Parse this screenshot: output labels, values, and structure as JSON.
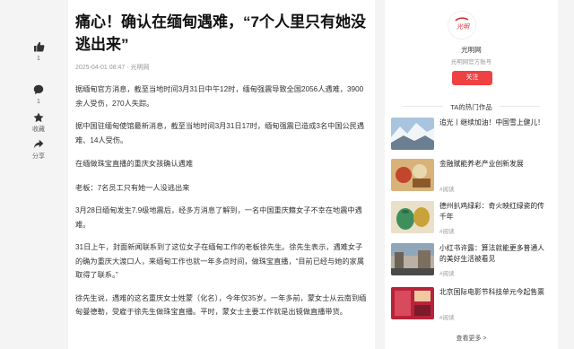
{
  "actions": {
    "like_count": "1",
    "comment_count": "1",
    "favorite_label": "收藏",
    "share_label": "分享"
  },
  "article": {
    "title": "痛心！确认在缅甸遇难，“7个人里只有她没逃出来”",
    "meta": "2025-04-01 08:47 · 光明网",
    "paragraphs": [
      "据缅甸官方消息，截至当地时间3月31日中午12时，缅甸强震导致全国2056人遇难，3900余人受伤，270人失踪。",
      "据中国驻缅甸使馆最新消息，截至当地时间3月31日17时，缅甸强震已造成3名中国公民遇难、14人受伤。",
      "在缅做珠宝直播的重庆女孩确认遇难",
      "老板：7名员工只有她一人没逃出来",
      "3月28日缅甸发生7.9级地震后，经多方消息了解到，一名中国重庆籍女子不幸在地震中遇难。",
      "31日上午，封面新闻联系到了这位女子在缅甸工作的老板徐先生。徐先生表示，遇难女子的确为重庆大渡口人，来缅甸工作也就一年多点时间，做珠宝直播，“目前已经与她的家属取得了联系。”",
      "徐先生说，遇难的这名重庆女士姓蒙（化名），今年仅35岁。一年多前，蒙女士从云南到缅甸曼德勒，受雇于徐先生做珠宝直播。平时，蒙女士主要工作就是出镜做直播带货。"
    ]
  },
  "author": {
    "name": "光明网",
    "desc": "光明网官方账号",
    "follow_label": "关注",
    "logo_text": "光明"
  },
  "hot": {
    "title": "TA的热门作品",
    "items": [
      {
        "text": "追光丨继续加油！中国雪上健儿！",
        "views": "",
        "thumb": "snow-mountain"
      },
      {
        "text": "金融赋能养老产业创新发展",
        "views": "#阅读",
        "thumb": "food-finance"
      },
      {
        "text": "德州扒鸡绿彩：奇火映红绿瓷的传千年",
        "views": "#阅读",
        "thumb": "ceramic"
      },
      {
        "text": "小红书许露：算法就能更多普通人的美好生活被看见",
        "views": "#阅读",
        "thumb": "city-street"
      },
      {
        "text": "北京国际电影节科技单元今起售票",
        "views": "#阅读",
        "thumb": "film-poster"
      }
    ],
    "more_label": "查看更多 >"
  },
  "colors": {
    "follow": "#f04142",
    "brand": "#d92c2c"
  }
}
